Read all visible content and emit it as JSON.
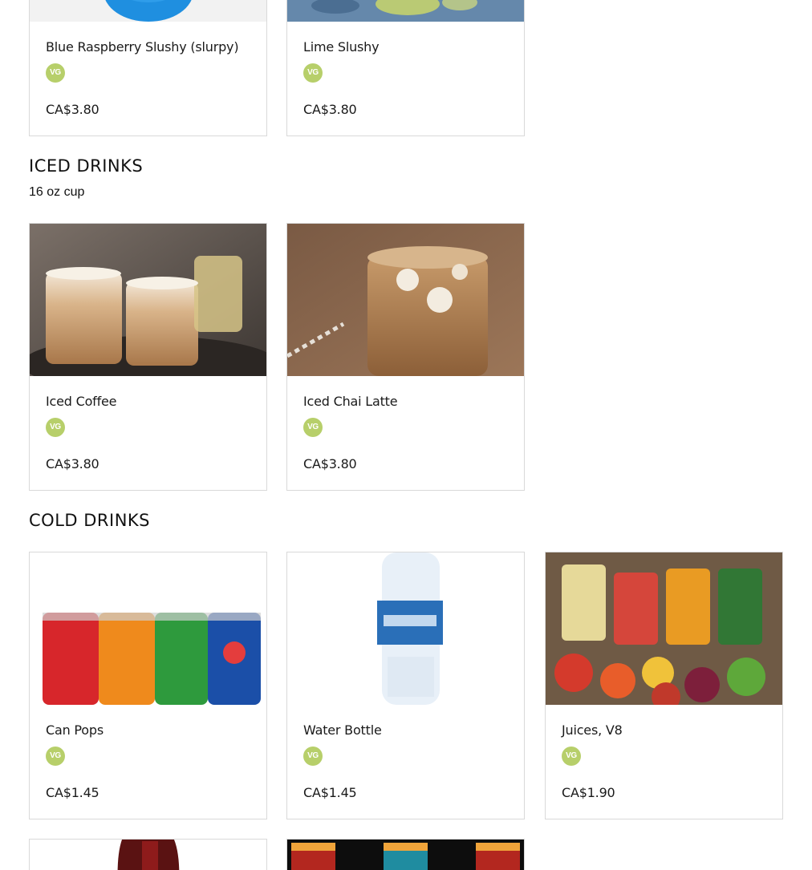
{
  "top_items": [
    {
      "name": "Blue Raspberry Slushy (slurpy)",
      "badge": "VG",
      "price": "CA$3.80"
    },
    {
      "name": "Lime Slushy",
      "badge": "VG",
      "price": "CA$3.80"
    }
  ],
  "iced_drinks": {
    "title": "ICED DRINKS",
    "subtitle": "16 oz cup",
    "items": [
      {
        "name": "Iced Coffee",
        "badge": "VG",
        "price": "CA$3.80"
      },
      {
        "name": "Iced Chai Latte",
        "badge": "VG",
        "price": "CA$3.80"
      }
    ]
  },
  "cold_drinks": {
    "title": "COLD DRINKS",
    "items": [
      {
        "name": "Can Pops",
        "badge": "VG",
        "price": "CA$1.45"
      },
      {
        "name": "Water Bottle",
        "badge": "VG",
        "price": "CA$1.45"
      },
      {
        "name": "Juices, V8",
        "badge": "VG",
        "price": "CA$1.90"
      }
    ]
  },
  "colors": {
    "badge": "#b7cf6a",
    "border": "#d9d9d9"
  }
}
